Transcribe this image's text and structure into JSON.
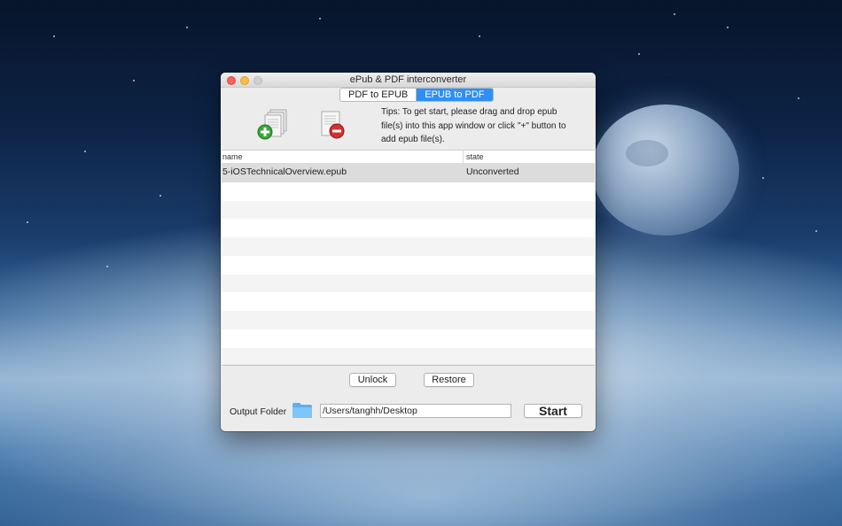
{
  "window": {
    "title": "ePub & PDF interconverter"
  },
  "tabs": [
    {
      "label": "PDF to EPUB",
      "active": false
    },
    {
      "label": "EPUB to PDF",
      "active": true
    }
  ],
  "toolbar": {
    "add_icon": "add-document-icon",
    "remove_icon": "remove-document-icon"
  },
  "tips": "Tips:  To get start, please drag and drop epub file(s) into this app window or click \"+\" button to add epub file(s).",
  "table": {
    "columns": [
      "name",
      "state"
    ],
    "rows": [
      {
        "name": "5-iOSTechnicalOverview.epub",
        "state": "Unconverted"
      }
    ]
  },
  "buttons": {
    "unlock": "Unlock",
    "restore": "Restore",
    "start": "Start"
  },
  "output": {
    "label": "Output Folder",
    "path": "/Users/tanghh/Desktop",
    "folder_icon": "folder-icon"
  },
  "colors": {
    "accent": "#2f8ff7",
    "close": "#fc605c",
    "minimize": "#fdbc40"
  }
}
